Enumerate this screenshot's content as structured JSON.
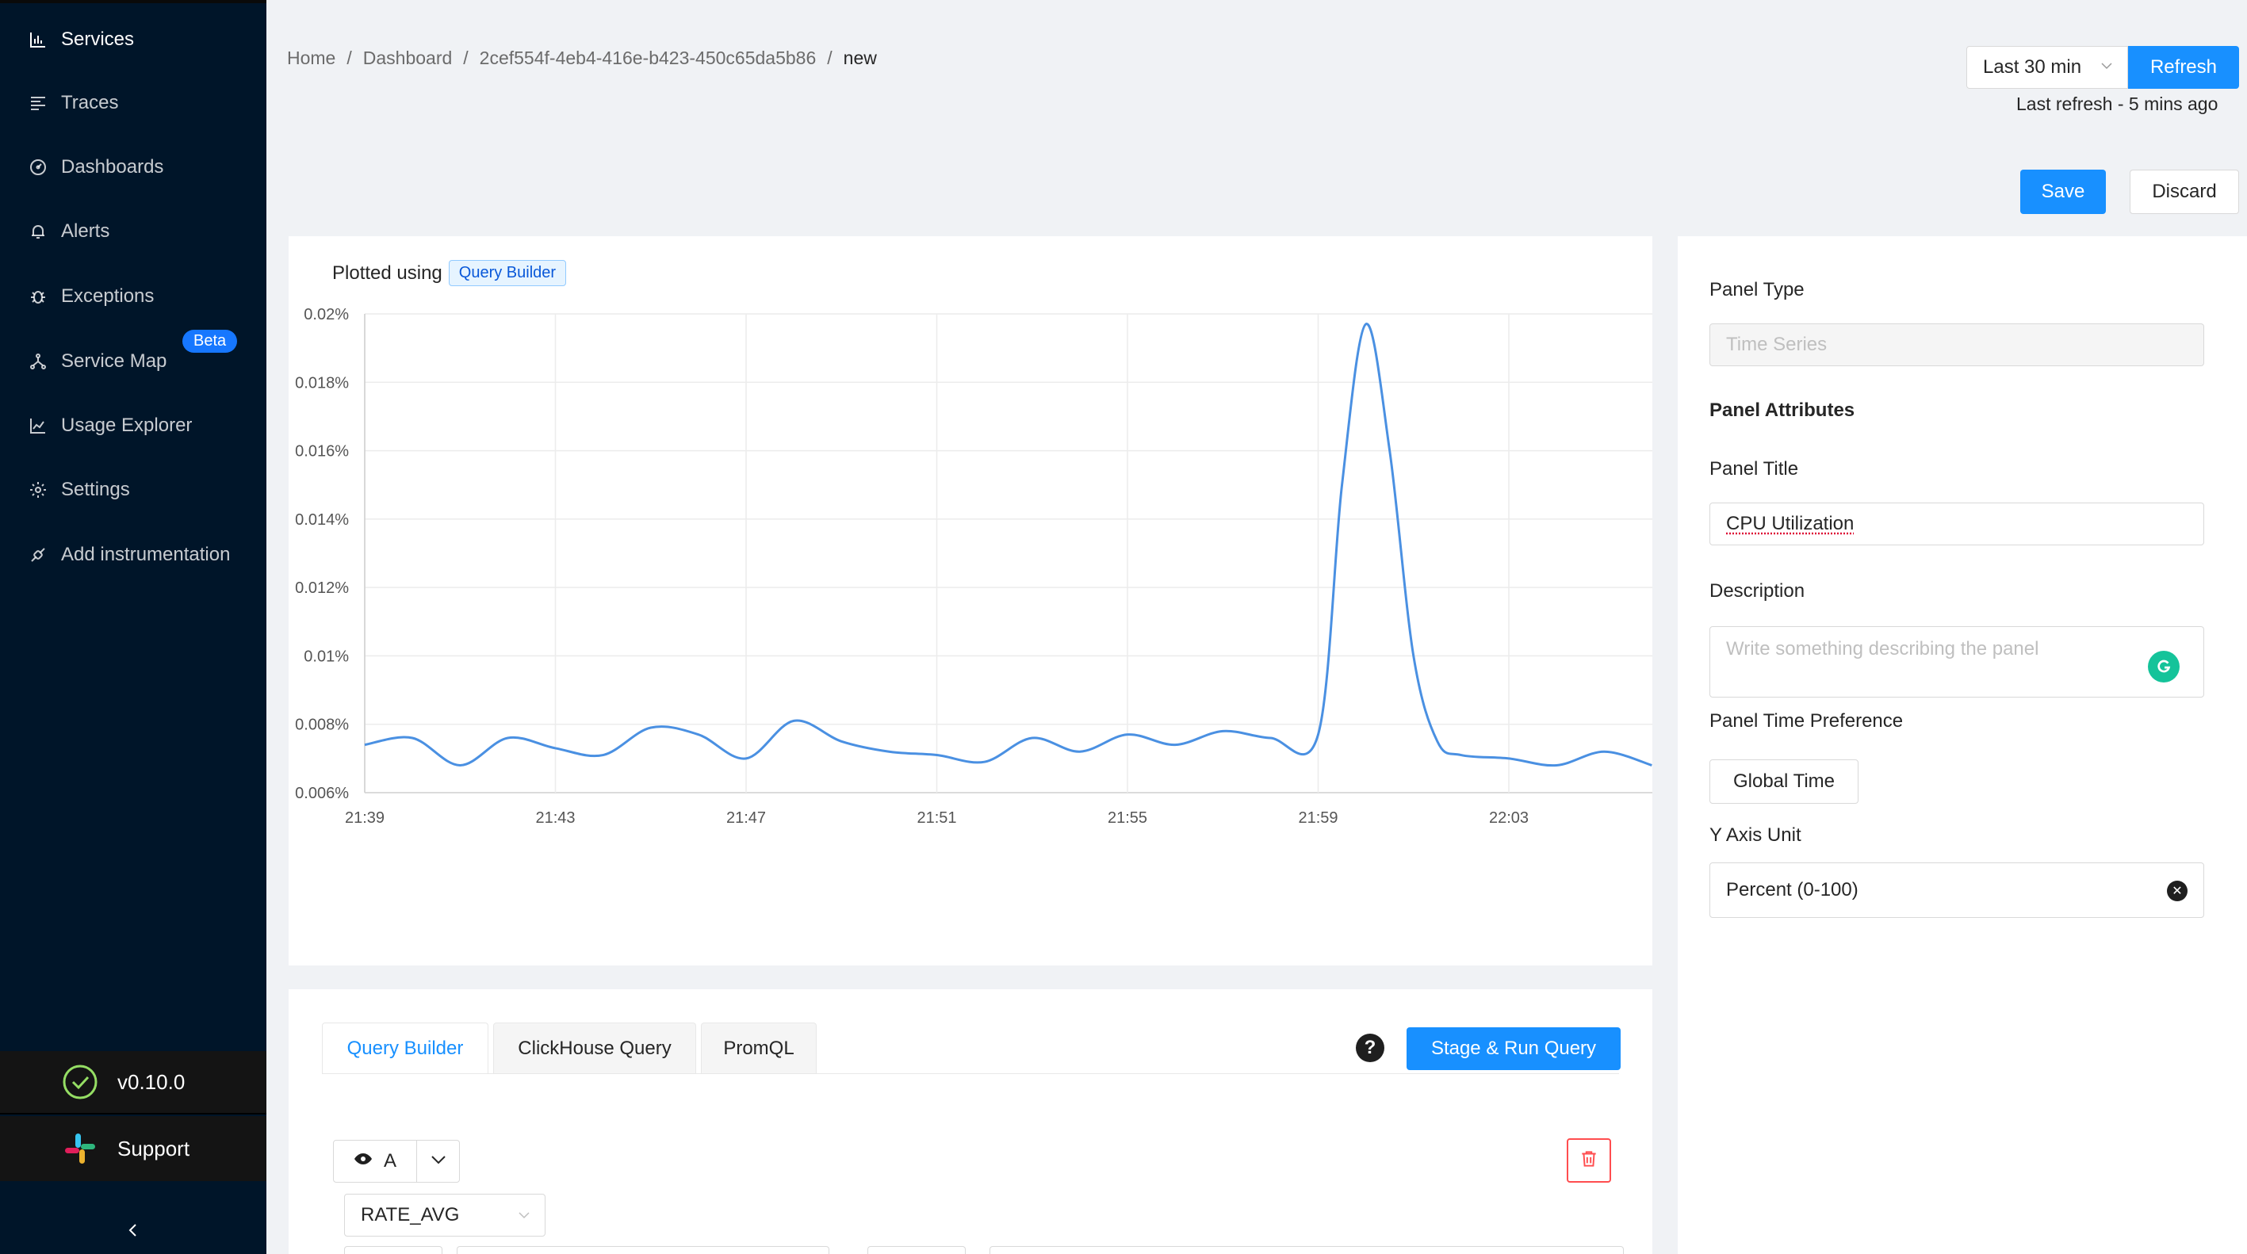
{
  "sidebar": {
    "items": [
      {
        "label": "Services",
        "icon": "bar-chart-icon"
      },
      {
        "label": "Traces",
        "icon": "align-left-icon"
      },
      {
        "label": "Dashboards",
        "icon": "dashboard-icon"
      },
      {
        "label": "Alerts",
        "icon": "bell-icon"
      },
      {
        "label": "Exceptions",
        "icon": "bug-icon"
      },
      {
        "label": "Service Map",
        "icon": "deployment-unit-icon",
        "badge": "Beta"
      },
      {
        "label": "Usage Explorer",
        "icon": "line-chart-icon"
      },
      {
        "label": "Settings",
        "icon": "gear-icon"
      },
      {
        "label": "Add instrumentation",
        "icon": "api-icon"
      }
    ],
    "version": "v0.10.0",
    "support": "Support"
  },
  "breadcrumb": [
    "Home",
    "Dashboard",
    "2cef554f-4eb4-416e-b423-450c65da5b86",
    "new"
  ],
  "header": {
    "time_range": "Last 30 min",
    "refresh_label": "Refresh",
    "last_refresh": "Last refresh - 5 mins ago",
    "save_label": "Save",
    "discard_label": "Discard"
  },
  "chart_panel": {
    "plotted_using": "Plotted using",
    "tag": "Query Builder"
  },
  "chart_data": {
    "type": "line",
    "title": "",
    "xlabel": "",
    "ylabel": "",
    "x_ticks": [
      "21:39",
      "21:43",
      "21:47",
      "21:51",
      "21:55",
      "21:59",
      "22:03"
    ],
    "y_ticks": [
      "0.006%",
      "0.008%",
      "0.01%",
      "0.012%",
      "0.014%",
      "0.016%",
      "0.018%",
      "0.02%"
    ],
    "ylim": [
      0.006,
      0.02
    ],
    "grid": true,
    "color": "#4a90e2",
    "series": [
      {
        "x": [
          "21:39",
          "21:40",
          "21:41",
          "21:42",
          "21:43",
          "21:44",
          "21:45",
          "21:46",
          "21:47",
          "21:48",
          "21:49",
          "21:50",
          "21:51",
          "21:52",
          "21:53",
          "21:54",
          "21:55",
          "21:56",
          "21:57",
          "21:58",
          "21:59",
          "21:59:30",
          "22:00",
          "22:00:30",
          "22:01",
          "22:01:30",
          "22:02",
          "22:03",
          "22:04",
          "22:05",
          "22:06"
        ],
        "values": [
          0.0074,
          0.0076,
          0.0068,
          0.0076,
          0.0073,
          0.0071,
          0.0079,
          0.0077,
          0.007,
          0.0081,
          0.0075,
          0.0072,
          0.0071,
          0.0069,
          0.0076,
          0.0072,
          0.0077,
          0.0074,
          0.0078,
          0.0076,
          0.0077,
          0.015,
          0.0197,
          0.016,
          0.01,
          0.0075,
          0.0071,
          0.007,
          0.0068,
          0.0072,
          0.0068
        ]
      }
    ]
  },
  "query_tabs": [
    "Query Builder",
    "ClickHouse Query",
    "PromQL"
  ],
  "query": {
    "help": "?",
    "run_label": "Stage & Run Query",
    "name": "A",
    "aggregation": "RATE_AVG"
  },
  "settings": {
    "panel_type_label": "Panel Type",
    "panel_type_value": "Time Series",
    "attributes_heading": "Panel Attributes",
    "title_label": "Panel Title",
    "title_value": "CPU Utilization",
    "description_label": "Description",
    "description_placeholder": "Write something describing the  panel",
    "time_pref_label": "Panel Time Preference",
    "time_pref_value": "Global Time",
    "y_unit_label": "Y Axis Unit",
    "y_unit_value": "Percent (0-100)"
  }
}
